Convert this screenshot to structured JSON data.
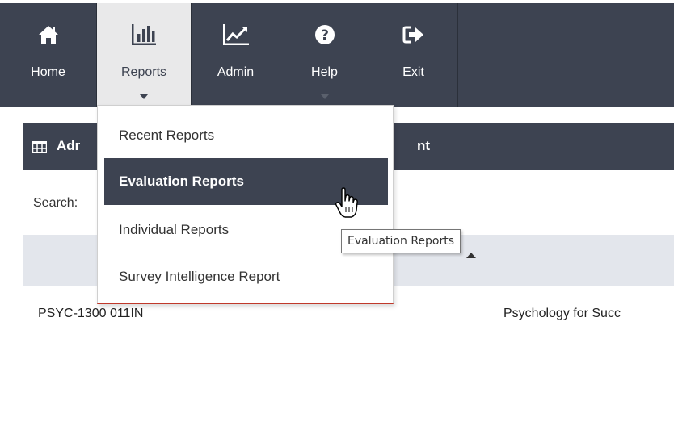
{
  "nav": {
    "items": [
      {
        "label": "Home",
        "icon": "home-icon"
      },
      {
        "label": "Reports",
        "icon": "bar-chart-icon",
        "active": true,
        "has_caret": true
      },
      {
        "label": "Admin",
        "icon": "line-chart-icon"
      },
      {
        "label": "Help",
        "icon": "question-circle-icon",
        "has_caret": true
      },
      {
        "label": "Exit",
        "icon": "sign-out-icon"
      }
    ]
  },
  "dropdown": {
    "items": [
      {
        "label": "Recent Reports"
      },
      {
        "label": "Evaluation Reports",
        "highlighted": true
      },
      {
        "label": "Individual Reports"
      },
      {
        "label": "Survey Intelligence Report"
      }
    ]
  },
  "tooltip": {
    "text": "Evaluation Reports"
  },
  "panel": {
    "title_start": "Adr",
    "title_end": "nt",
    "icon": "table-icon"
  },
  "search": {
    "label": "Search:"
  },
  "table": {
    "rows": [
      {
        "col1": "PSYC-1300 011IN",
        "col2": "Psychology for Succ"
      }
    ]
  },
  "colors": {
    "nav_bg": "#3d4351",
    "nav_active_bg": "#e9e9ea",
    "highlight_bg": "#3d4351",
    "table_head_bg": "#e3e6ec",
    "accent_red": "#c0392b"
  }
}
